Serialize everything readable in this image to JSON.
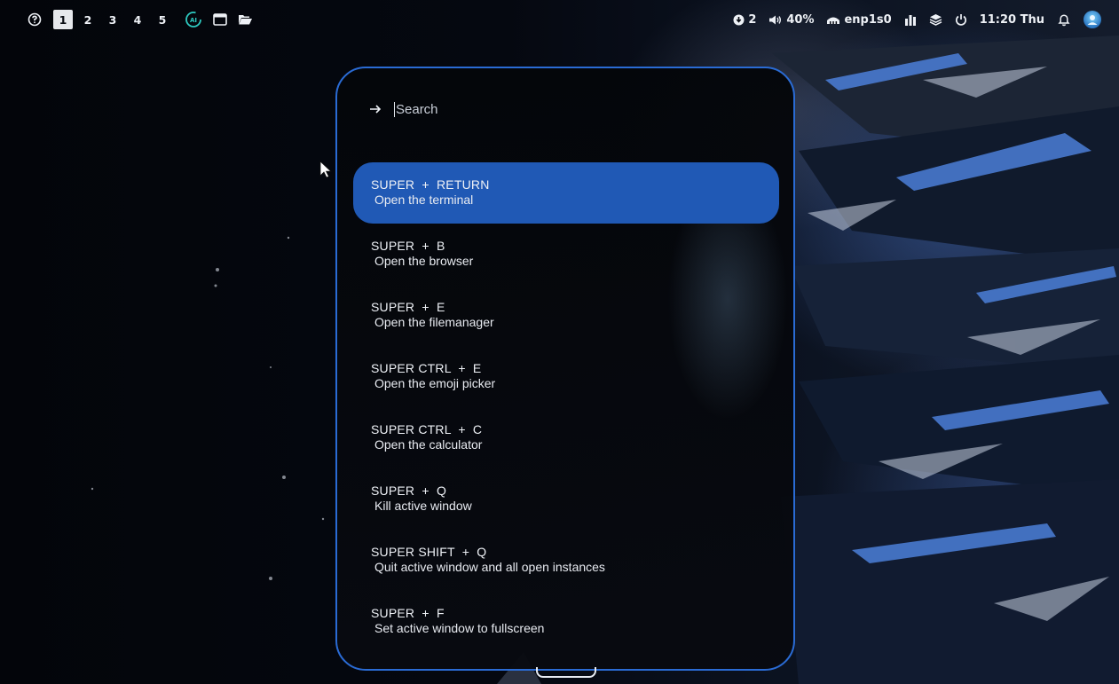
{
  "topbar": {
    "workspaces": [
      "1",
      "2",
      "3",
      "4",
      "5"
    ],
    "active_workspace": "1",
    "icons": [
      "help-circle-icon",
      "ai-assistant-icon",
      "window-icon",
      "folder-open-icon"
    ],
    "updates_count": "2",
    "volume": "40%",
    "network": "enp1s0",
    "clock": "11:20 Thu"
  },
  "launcher": {
    "search_placeholder": "Search",
    "entries": [
      {
        "keys": "SUPER  +  RETURN",
        "desc": "Open the terminal",
        "selected": true
      },
      {
        "keys": "SUPER  +  B",
        "desc": "Open the browser"
      },
      {
        "keys": "SUPER  +  E",
        "desc": "Open the filemanager"
      },
      {
        "keys": "SUPER CTRL  +  E",
        "desc": "Open the emoji picker"
      },
      {
        "keys": "SUPER CTRL  +  C",
        "desc": "Open the calculator"
      },
      {
        "keys": "SUPER  +  Q",
        "desc": "Kill active window"
      },
      {
        "keys": "SUPER SHIFT  +  Q",
        "desc": "Quit active window and all open instances"
      },
      {
        "keys": "SUPER  +  F",
        "desc": "Set active window to fullscreen"
      }
    ]
  },
  "colors": {
    "accent": "#2a6bd4",
    "selection": "#2059b5",
    "background": "#05070c"
  }
}
